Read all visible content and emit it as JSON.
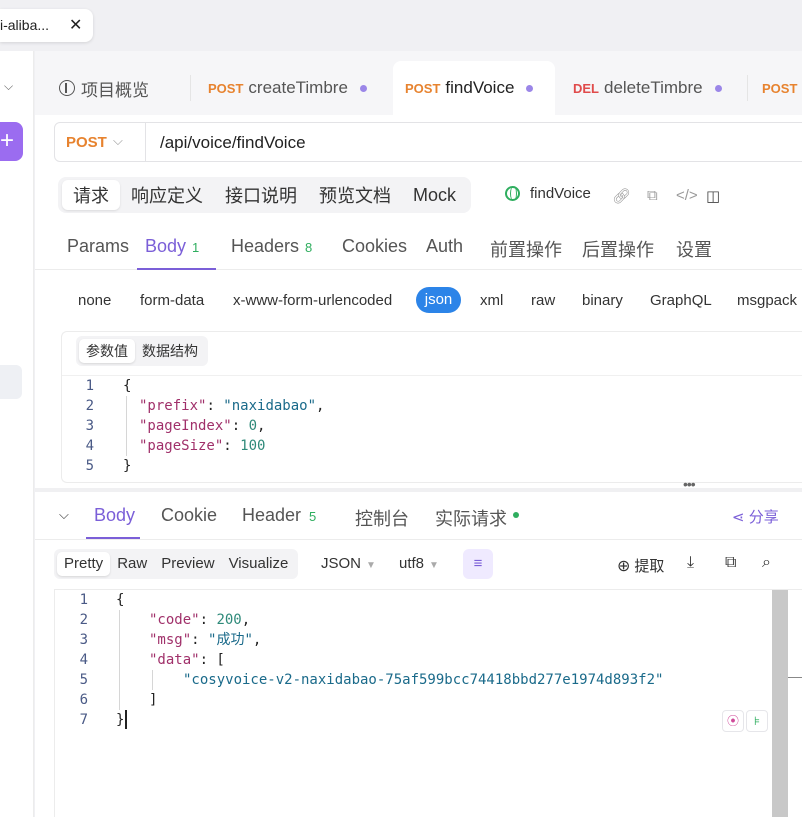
{
  "window_tab": {
    "title": "i-aliba...",
    "close": "✕"
  },
  "rail": {
    "add_label": "+",
    "collapse": "⌵"
  },
  "api_tabs": [
    {
      "method": "",
      "label": "项目概览"
    },
    {
      "method": "POST",
      "label": "createTimbre"
    },
    {
      "method": "POST",
      "label": "findVoice"
    },
    {
      "method": "DEL",
      "label": "deleteTimbre"
    },
    {
      "method": "POST",
      "label": ""
    }
  ],
  "request": {
    "method": "POST",
    "url": "/api/voice/findVoice",
    "sub_tabs": [
      "请求",
      "响应定义",
      "接口说明",
      "预览文档",
      "Mock"
    ],
    "operation_name": "findVoice",
    "param_tabs": [
      {
        "label": "Params",
        "count": ""
      },
      {
        "label": "Body",
        "count": "1"
      },
      {
        "label": "Headers",
        "count": "8"
      },
      {
        "label": "Cookies",
        "count": ""
      },
      {
        "label": "Auth",
        "count": ""
      },
      {
        "label": "前置操作",
        "count": ""
      },
      {
        "label": "后置操作",
        "count": ""
      },
      {
        "label": "设置",
        "count": ""
      }
    ],
    "body_types": [
      "none",
      "form-data",
      "x-www-form-urlencoded",
      "json",
      "xml",
      "raw",
      "binary",
      "GraphQL",
      "msgpack"
    ],
    "editor_toggle": [
      "参数值",
      "数据结构"
    ],
    "body": {
      "line_numbers": [
        "1",
        "2",
        "3",
        "4",
        "5"
      ],
      "open": "{",
      "close": "}",
      "fields": [
        {
          "key": "\"prefix\"",
          "value": "\"naxidabao\"",
          "trail": ","
        },
        {
          "key": "\"pageIndex\"",
          "value": "0",
          "trail": ","
        },
        {
          "key": "\"pageSize\"",
          "value": "100",
          "trail": ""
        }
      ]
    }
  },
  "response": {
    "tabs": [
      {
        "label": "Body",
        "count": ""
      },
      {
        "label": "Cookie",
        "count": ""
      },
      {
        "label": "Header",
        "count": "5"
      },
      {
        "label": "控制台",
        "count": ""
      },
      {
        "label": "实际请求",
        "count": ""
      }
    ],
    "share_label": "分享",
    "formats": [
      "Pretty",
      "Raw",
      "Preview",
      "Visualize"
    ],
    "content_type": "JSON",
    "encoding": "utf8",
    "extract_label": "提取",
    "body": {
      "line_numbers": [
        "1",
        "2",
        "3",
        "4",
        "5",
        "6",
        "7"
      ],
      "code_key": "\"code\"",
      "code_value": "200",
      "msg_key": "\"msg\"",
      "msg_value": "\"成功\"",
      "data_key": "\"data\"",
      "data_item": "\"cosyvoice-v2-naxidabao-75af599bcc74418bbd277e1974d893f2\""
    }
  }
}
